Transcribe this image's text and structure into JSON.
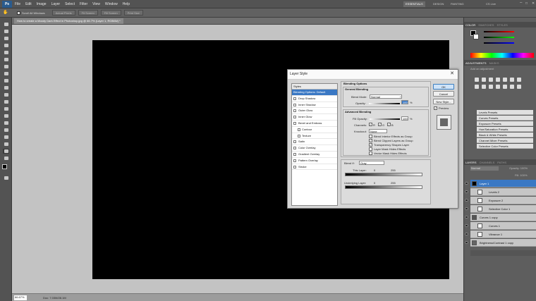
{
  "app": {
    "logo": "Ps",
    "menu": [
      "File",
      "Edit",
      "Image",
      "Layer",
      "Select",
      "Filter",
      "View",
      "Window",
      "Help"
    ],
    "workspaces": [
      "ESSENTIALS",
      "DESIGN",
      "PAINTING"
    ],
    "cs_live": "CS Live",
    "accent": "#3a78c4"
  },
  "options_bar": {
    "scroll_all_windows": "Scroll All Windows",
    "buttons": [
      "Actual Pixels",
      "Fit Screen",
      "Fill Screen",
      "Print Size"
    ]
  },
  "document": {
    "tab_title": "How to create a Moody Dark Effect in Photoshop.jpg @ 66.7% (Layer 1, RGB/8#) *",
    "zoom": "66.67%",
    "doc_info": "Doc: 7.03M/28.1M"
  },
  "panels": {
    "color_tabs": [
      "COLOR",
      "SWATCHES",
      "STYLES"
    ],
    "adjustments_tabs": [
      "ADJUSTMENTS",
      "MASKS"
    ],
    "adjustments_hint": "Add an adjustment",
    "presets": [
      "Levels Presets",
      "Curves Presets",
      "Exposure Presets",
      "Hue/Saturation Presets",
      "Black & White Presets",
      "Channel Mixer Presets",
      "Selective Color Presets"
    ],
    "layers_tabs": [
      "LAYERS",
      "CHANNELS",
      "PATHS"
    ],
    "blend": "Normal",
    "opacity": "Opacity: 100%",
    "fill": "Fill: 100%",
    "layers": [
      "Layer 1",
      "Levels 2",
      "Exposure 2",
      "Selective Color 1",
      "Curves 1 copy",
      "Curves 1",
      "Vibrance 1",
      "Brightness/Contrast 1 copy"
    ]
  },
  "dialog": {
    "title": "Layer Style",
    "close": "✕",
    "styles_header": "Styles",
    "styles": [
      {
        "label": "Blending Options: Default",
        "selected": true
      },
      {
        "label": "Drop Shadow"
      },
      {
        "label": "Inner Shadow"
      },
      {
        "label": "Outer Glow"
      },
      {
        "label": "Inner Glow"
      },
      {
        "label": "Bevel and Emboss"
      },
      {
        "label": "Contour",
        "sub": true
      },
      {
        "label": "Texture",
        "sub": true
      },
      {
        "label": "Satin"
      },
      {
        "label": "Color Overlay"
      },
      {
        "label": "Gradient Overlay"
      },
      {
        "label": "Pattern Overlay"
      },
      {
        "label": "Stroke"
      }
    ],
    "blending_options": "Blending Options",
    "general_blending": "General Blending",
    "blend_mode_label": "Blend Mode:",
    "blend_mode": "Normal",
    "opacity_label": "Opacity:",
    "opacity": "100",
    "percent": "%",
    "advanced_blending": "Advanced Blending",
    "fill_opacity_label": "Fill Opacity:",
    "fill_opacity": "100",
    "channels_label": "Channels:",
    "channels": [
      "R",
      "G",
      "B"
    ],
    "knockout_label": "Knockout:",
    "knockout": "None",
    "checkboxes": [
      {
        "label": "Blend Interior Effects as Group",
        "checked": false
      },
      {
        "label": "Blend Clipped Layers as Group",
        "checked": true
      },
      {
        "label": "Transparency Shapes Layer",
        "checked": true
      },
      {
        "label": "Layer Mask Hides Effects",
        "checked": false
      },
      {
        "label": "Vector Mask Hides Effects",
        "checked": false
      }
    ],
    "blend_if_label": "Blend If:",
    "blend_if": "Gray",
    "this_layer_label": "This Layer:",
    "this_layer_min": "0",
    "this_layer_max": "255",
    "underlying_label": "Underlying Layer:",
    "underlying_min": "0",
    "underlying_max": "255",
    "ok": "OK",
    "cancel": "Cancel",
    "new_style": "New Style...",
    "preview": "Preview"
  }
}
